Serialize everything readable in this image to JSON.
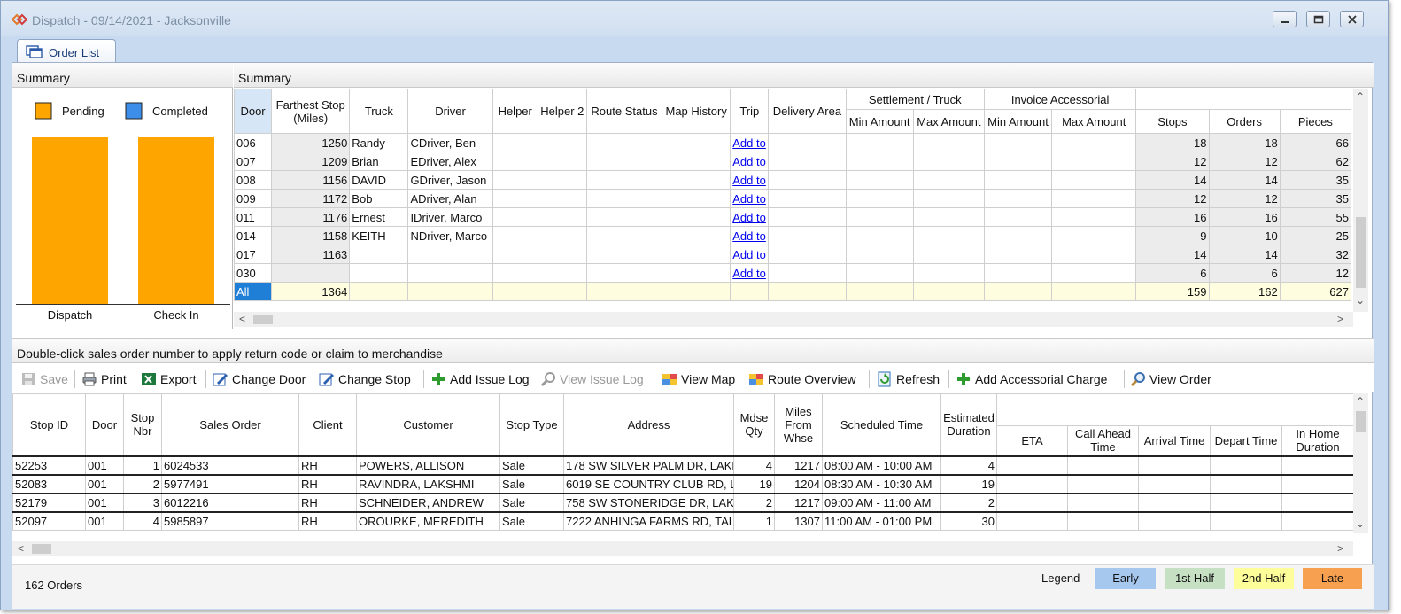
{
  "window": {
    "title": "Dispatch - 09/14/2021 - Jacksonville",
    "tab": "Order List"
  },
  "summary_left": {
    "title": "Summary"
  },
  "chart_data": {
    "type": "bar",
    "categories": [
      "Dispatch",
      "Check In"
    ],
    "series": [
      {
        "name": "Pending",
        "values": [
          1,
          1
        ],
        "color": "#ffa500"
      },
      {
        "name": "Completed",
        "values": [
          0,
          0
        ],
        "color": "#3d8ee8"
      }
    ],
    "ylim": [
      0,
      1
    ],
    "legend": "top",
    "grid": false
  },
  "summary_grid": {
    "title": "Summary",
    "group_headers": {
      "settlement": "Settlement / Truck",
      "invoice": "Invoice Accessorial"
    },
    "headers": {
      "door": "Door",
      "farthest": "Farthest Stop (Miles)",
      "truck": "Truck",
      "driver": "Driver",
      "helper": "Helper",
      "helper2": "Helper 2",
      "route_status": "Route Status",
      "map_history": "Map History",
      "trip": "Trip",
      "delivery_area": "Delivery Area",
      "min_amount": "Min Amount",
      "max_amount": "Max Amount",
      "inv_min": "Min Amount",
      "inv_max": "Max Amount",
      "stops": "Stops",
      "orders": "Orders",
      "pieces": "Pieces"
    },
    "rows": [
      {
        "door": "006",
        "farthest": "1250",
        "truck": "Randy",
        "driver": "CDriver, Ben",
        "trip": "Add to",
        "stops": "18",
        "orders": "18",
        "pieces": "66"
      },
      {
        "door": "007",
        "farthest": "1209",
        "truck": "Brian",
        "driver": "EDriver, Alex",
        "trip": "Add to",
        "stops": "12",
        "orders": "12",
        "pieces": "62"
      },
      {
        "door": "008",
        "farthest": "1156",
        "truck": "DAVID",
        "driver": "GDriver, Jason",
        "trip": "Add to",
        "stops": "14",
        "orders": "14",
        "pieces": "35"
      },
      {
        "door": "009",
        "farthest": "1172",
        "truck": "Bob",
        "driver": "ADriver, Alan",
        "trip": "Add to",
        "stops": "12",
        "orders": "12",
        "pieces": "35"
      },
      {
        "door": "011",
        "farthest": "1176",
        "truck": "Ernest",
        "driver": "IDriver, Marco",
        "trip": "Add to",
        "stops": "16",
        "orders": "16",
        "pieces": "55"
      },
      {
        "door": "014",
        "farthest": "1158",
        "truck": "KEITH",
        "driver": "NDriver, Marco",
        "trip": "Add to",
        "stops": "9",
        "orders": "10",
        "pieces": "25"
      },
      {
        "door": "017",
        "farthest": "1163",
        "truck": "",
        "driver": "",
        "trip": "Add to",
        "stops": "14",
        "orders": "14",
        "pieces": "32"
      },
      {
        "door": "030",
        "farthest": "",
        "truck": "",
        "driver": "",
        "trip": "Add to",
        "stops": "6",
        "orders": "6",
        "pieces": "12"
      }
    ],
    "total": {
      "door": "All",
      "farthest": "1364",
      "stops": "159",
      "orders": "162",
      "pieces": "627"
    }
  },
  "info_text": "Double-click sales order number to apply return code or claim to merchandise",
  "toolbar": {
    "save": "Save",
    "print": "Print",
    "export": "Export",
    "change_door": "Change Door",
    "change_stop": "Change Stop",
    "add_issue_log": "Add Issue Log",
    "view_issue_log": "View Issue Log",
    "view_map": "View Map",
    "route_overview": "Route Overview",
    "refresh": "Refresh",
    "add_accessorial": "Add Accessorial Charge",
    "view_order": "View Order"
  },
  "stops_grid": {
    "headers": {
      "stop_id": "Stop ID",
      "door": "Door",
      "stop_nbr": "Stop Nbr",
      "sales_order": "Sales Order",
      "client": "Client",
      "customer": "Customer",
      "stop_type": "Stop Type",
      "address": "Address",
      "mdse_qty": "Mdse Qty",
      "miles": "Miles From Whse",
      "scheduled": "Scheduled Time",
      "est_duration": "Estimated Duration",
      "eta": "ETA",
      "call_ahead": "Call Ahead Time",
      "arrival": "Arrival Time",
      "depart": "Depart Time",
      "in_home": "In Home Duration"
    },
    "rows": [
      {
        "stop_id": "52253",
        "door": "001",
        "stop_nbr": "1",
        "sales_order": "6024533",
        "client": "RH",
        "customer": "POWERS, ALLISON",
        "stop_type": "Sale",
        "address": "178 SW SILVER PALM DR, LAKE",
        "mdse_qty": "4",
        "miles": "1217",
        "scheduled": "08:00 AM - 10:00 AM",
        "est_duration": "4"
      },
      {
        "stop_id": "52083",
        "door": "001",
        "stop_nbr": "2",
        "sales_order": "5977491",
        "client": "RH",
        "customer": "RAVINDRA, LAKSHMI",
        "stop_type": "Sale",
        "address": "6019 SE COUNTRY CLUB RD, LA",
        "mdse_qty": "19",
        "miles": "1204",
        "scheduled": "08:30 AM - 10:30 AM",
        "est_duration": "19"
      },
      {
        "stop_id": "52179",
        "door": "001",
        "stop_nbr": "3",
        "sales_order": "6012216",
        "client": "RH",
        "customer": "SCHNEIDER, ANDREW",
        "stop_type": "Sale",
        "address": "758 SW STONERIDGE DR, LAKE",
        "mdse_qty": "2",
        "miles": "1217",
        "scheduled": "09:00 AM - 11:00 AM",
        "est_duration": "2"
      },
      {
        "stop_id": "52097",
        "door": "001",
        "stop_nbr": "4",
        "sales_order": "5985897",
        "client": "RH",
        "customer": "OROURKE, MEREDITH",
        "stop_type": "Sale",
        "address": "7222 ANHINGA FARMS RD, TAL",
        "mdse_qty": "1",
        "miles": "1307",
        "scheduled": "11:00 AM - 01:00 PM",
        "est_duration": "30"
      }
    ]
  },
  "status": {
    "count": "162 Orders"
  },
  "legend": {
    "label": "Legend",
    "items": [
      {
        "label": "Early",
        "color": "#a6c8ef"
      },
      {
        "label": "1st Half",
        "color": "#c5e0c3"
      },
      {
        "label": "2nd Half",
        "color": "#fdfd99"
      },
      {
        "label": "Late",
        "color": "#f7a04f"
      }
    ]
  }
}
